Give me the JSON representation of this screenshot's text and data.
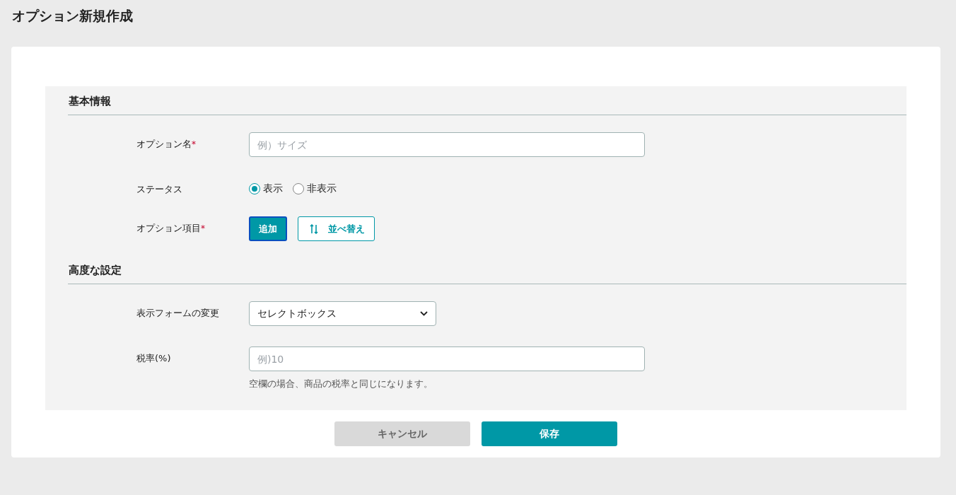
{
  "page_title": "オプション新規作成",
  "sections": [
    {
      "heading": "基本情報",
      "fields": [
        {
          "kind": "text",
          "label": "オプション名",
          "required_mark": "*",
          "placeholder": "例）サイズ"
        },
        {
          "kind": "radio",
          "label": "ステータス",
          "options": [
            {
              "label": "表示",
              "selected": true
            },
            {
              "label": "非表示",
              "selected": false
            }
          ]
        },
        {
          "kind": "buttons",
          "label": "オプション項目",
          "required_mark": "*",
          "buttons": [
            {
              "label": "追加",
              "kind": "primary"
            },
            {
              "label": "並べ替え",
              "kind": "sort"
            }
          ]
        }
      ]
    },
    {
      "heading": "高度な設定",
      "fields": [
        {
          "kind": "select",
          "label": "表示フォームの変更",
          "value": "セレクトボックス"
        },
        {
          "kind": "text",
          "label": "税率(%)",
          "placeholder": "例)10",
          "hint": "空欄の場合、商品の税率と同じになります。"
        }
      ]
    }
  ],
  "actions": [
    {
      "label": "キャンセル",
      "kind": "secondary"
    },
    {
      "label": "保存",
      "kind": "primary"
    }
  ]
}
